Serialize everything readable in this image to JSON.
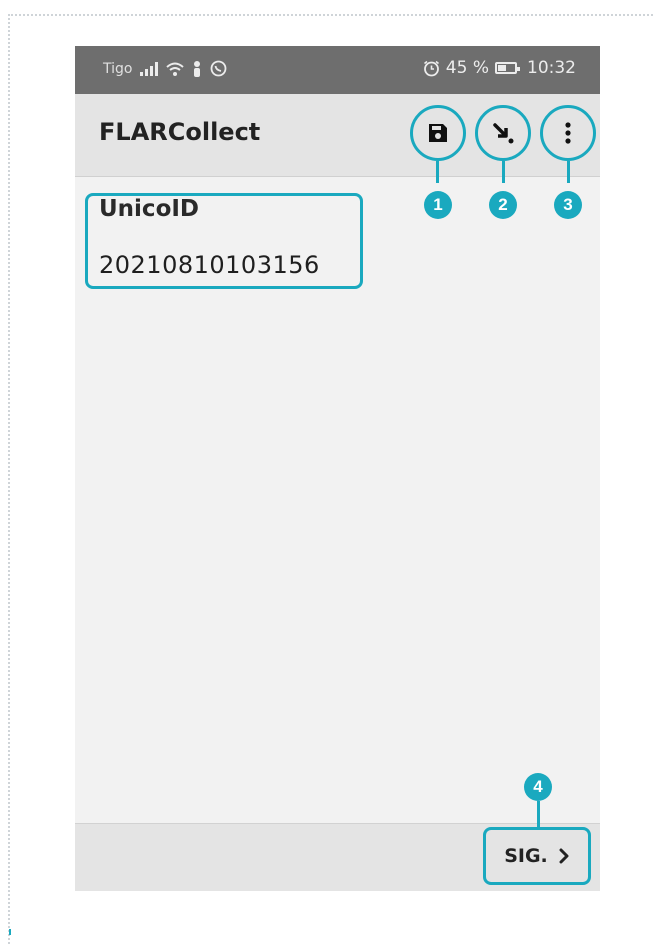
{
  "status_bar": {
    "carrier": "Tigo",
    "battery": "45 %",
    "time": "10:32"
  },
  "app_bar": {
    "title": "FLARCollect",
    "actions": [
      {
        "icon": "save-icon",
        "badge": "1"
      },
      {
        "icon": "arrow-down-right-icon",
        "badge": "2"
      },
      {
        "icon": "more-vert-icon",
        "badge": "3"
      }
    ]
  },
  "form": {
    "field_label": "UnicoID",
    "field_value": "20210810103156"
  },
  "bottom_bar": {
    "next_label": "SIG.",
    "next_badge": "4"
  },
  "colors": {
    "accent": "#1aa9bf",
    "status_bar": "#6e6e6e",
    "app_bar": "#e4e4e4",
    "background": "#f2f2f2"
  }
}
